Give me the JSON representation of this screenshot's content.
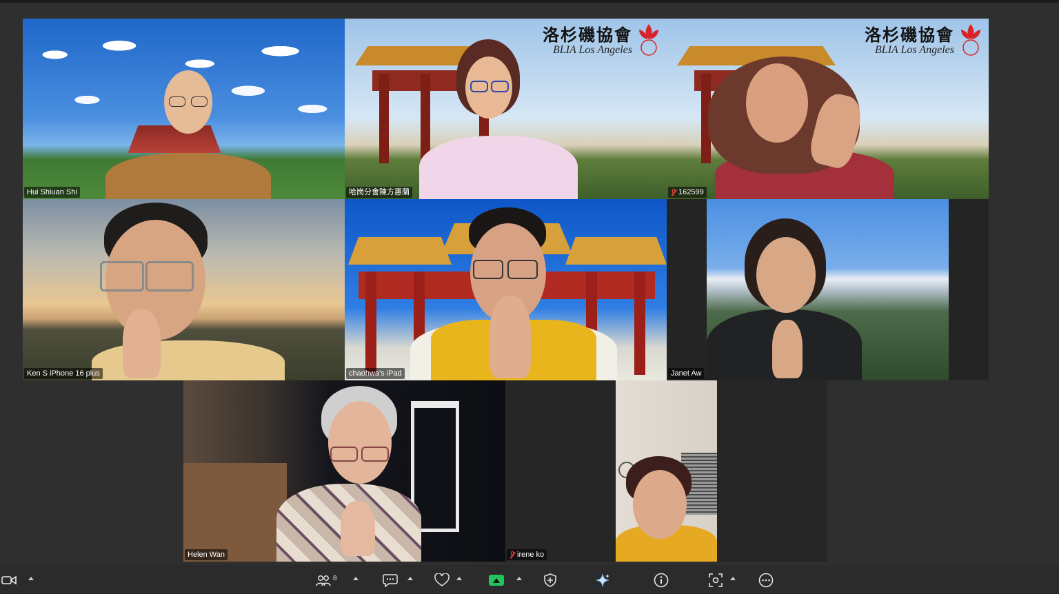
{
  "participants": [
    {
      "id": "p1",
      "name": "Hui Shiuan Shi",
      "muted": false
    },
    {
      "id": "p2",
      "name": "哈崗分會陳方惠蘭",
      "muted": false
    },
    {
      "id": "p3",
      "name": "162599",
      "muted": true
    },
    {
      "id": "p4",
      "name": "Ken S iPhone 16 plus",
      "muted": false,
      "active_speaker": true
    },
    {
      "id": "p5",
      "name": "chaohwa's iPad",
      "muted": false
    },
    {
      "id": "p6",
      "name": "Janet Aw",
      "muted": false
    },
    {
      "id": "p7",
      "name": "Helen Wan",
      "muted": false
    },
    {
      "id": "p8",
      "name": "irene ko",
      "muted": true
    }
  ],
  "watermark": {
    "zh": "洛杉磯協會",
    "en": "BLIA Los Angeles",
    "seal": "佛光 BLIA"
  },
  "toolbar": {
    "participants_count": "8",
    "icons": [
      "video-icon",
      "participants-icon",
      "chat-icon",
      "react-icon",
      "share-screen-icon",
      "security-icon",
      "ai-companion-icon",
      "info-icon",
      "apps-icon",
      "more-icon"
    ]
  },
  "colors": {
    "active_border": "#2fd36c",
    "share_green": "#23c45e",
    "muted_red": "#e8413a",
    "background": "#2f2f2f"
  }
}
